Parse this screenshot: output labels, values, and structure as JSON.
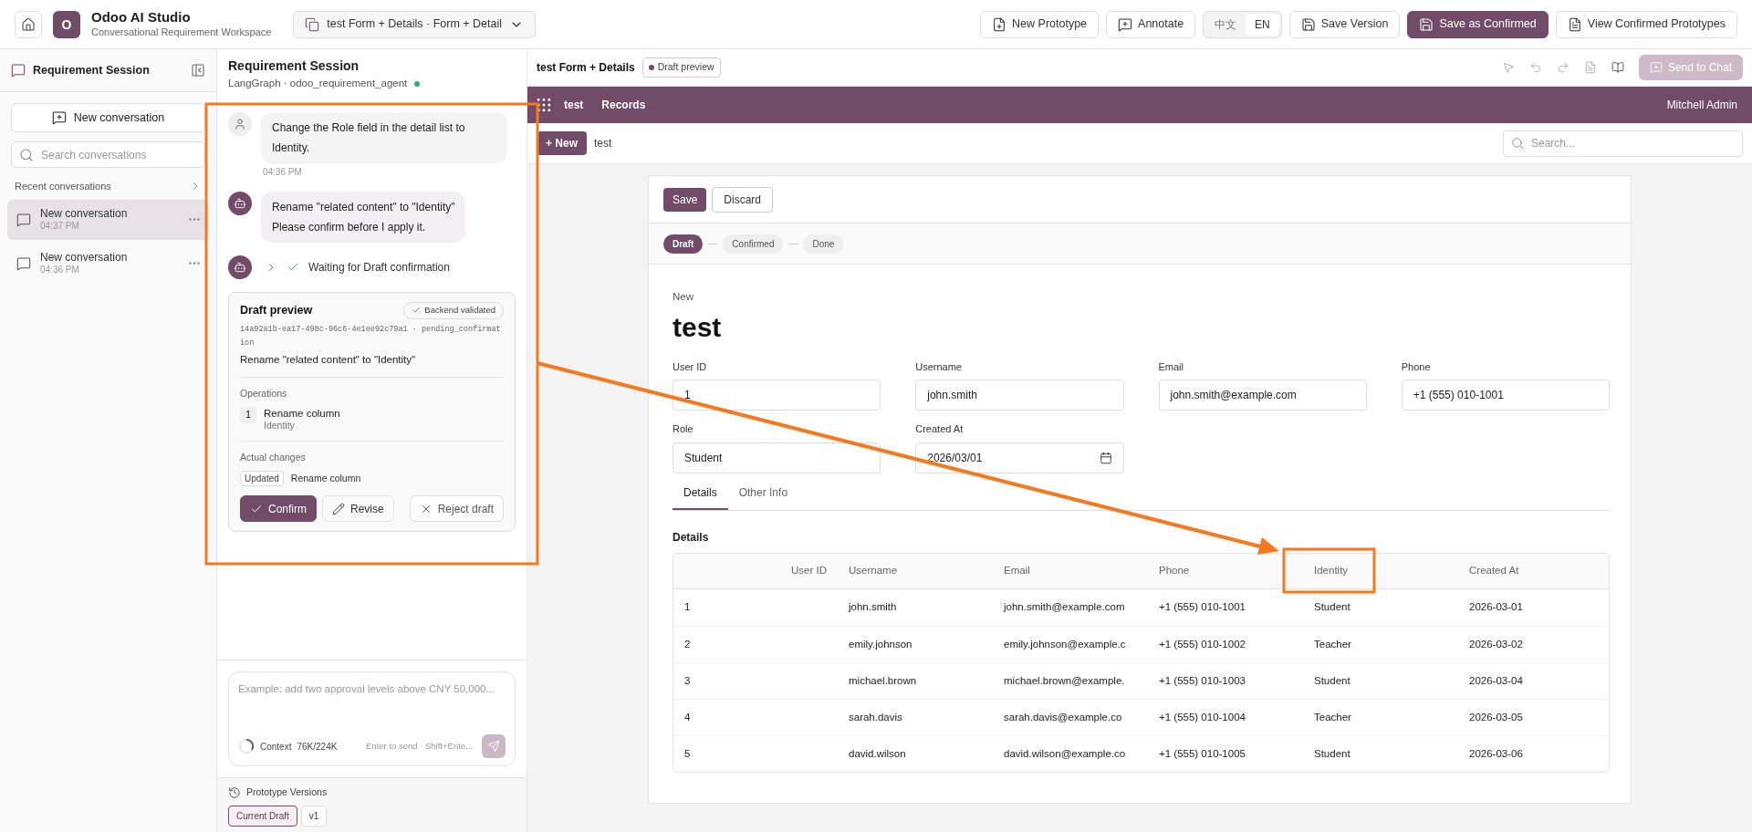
{
  "app": {
    "logo_letter": "O",
    "title": "Odoo AI Studio",
    "subtitle": "Conversational Requirement Workspace",
    "prototype_select": "test Form + Details · Form + Detail"
  },
  "toolbar": {
    "tools": [
      {
        "label": "New Prototype",
        "kind": "new"
      },
      {
        "label": "Annotate",
        "kind": "annotate"
      }
    ],
    "languages": [
      {
        "label": "中文",
        "selected": false
      },
      {
        "label": "EN",
        "selected": true
      }
    ],
    "actions": [
      {
        "label": "Save Version",
        "kind": "save",
        "primary": false
      },
      {
        "label": "Save as Confirmed",
        "kind": "save",
        "primary": true
      },
      {
        "label": "View Confirmed Prototypes",
        "kind": "doc",
        "primary": false
      }
    ]
  },
  "sidebar": {
    "title": "Requirement Session",
    "new_button": "New conversation",
    "search": {
      "placeholder": "Search conversations"
    },
    "section": "Recent conversations",
    "conversations": [
      {
        "title": "New conversation",
        "time": "04:37 PM",
        "selected": true
      },
      {
        "title": "New conversation",
        "time": "04:36 PM",
        "selected": false
      }
    ]
  },
  "chat": {
    "title": "Requirement Session",
    "subtitle": "LangGraph · odoo_requirement_agent",
    "online": true,
    "messages": [
      {
        "kind": "user",
        "lines": [
          "Change the Role field in the detail list to Identity."
        ],
        "time": "04:36 PM"
      },
      {
        "kind": "assistant",
        "lines": [
          "Rename \"related content\" to \"Identity\"",
          "Please confirm before I apply it."
        ]
      }
    ],
    "status": {
      "text": "Waiting for Draft confirmation",
      "done": true
    },
    "draft": {
      "title": "Draft preview",
      "badge": "Backend validated",
      "id_line": "14a92a1b-ea17-498c-96c6-4e1ee92c79a1 · pending_confirmation",
      "summary": "Rename \"related content\" to \"Identity\"",
      "operations_label": "Operations",
      "operations": [
        {
          "index": "1",
          "title": "Rename column",
          "detail": "Identity"
        }
      ],
      "changes_label": "Actual changes",
      "changes": [
        {
          "tag": "Updated",
          "text": "Rename column"
        }
      ],
      "buttons": [
        {
          "label": "Confirm",
          "kind": "confirm"
        },
        {
          "label": "Revise",
          "kind": "revise"
        },
        {
          "label": "Reject draft",
          "kind": "reject"
        }
      ]
    },
    "composer": {
      "placeholder": "Example: add two approval levels above CNY 50,000...",
      "context_label": "Context",
      "context_value": "76K/224K",
      "level": 0.34,
      "hint": "Enter to send · Shift+Ente..."
    },
    "versions": {
      "title": "Prototype Versions",
      "items": [
        {
          "label": "Current Draft",
          "selected": true
        },
        {
          "label": "v1",
          "selected": false
        }
      ]
    }
  },
  "preview": {
    "title": "test Form + Details",
    "badge": "Draft preview",
    "send_button": {
      "label": "Send to Chat",
      "disabled": true
    },
    "navbar": {
      "app": "test",
      "menu": "Records",
      "user": "Mitchell Admin"
    },
    "control": {
      "new_button": "+ New",
      "breadcrumb": "test",
      "search_placeholder": "Search..."
    },
    "form": {
      "save": "Save",
      "discard": "Discard",
      "stages": [
        {
          "label": "Draft",
          "selected": true
        },
        {
          "label": "Confirmed",
          "selected": false
        },
        {
          "label": "Done",
          "selected": false
        }
      ],
      "record_label": "New",
      "record_title": "test",
      "fields": [
        {
          "label": "User ID",
          "value": "1",
          "kind": "text"
        },
        {
          "label": "Username",
          "value": "john.smith",
          "kind": "text"
        },
        {
          "label": "Email",
          "value": "john.smith@example.com",
          "kind": "text"
        },
        {
          "label": "Phone",
          "value": "+1 (555) 010-1001",
          "kind": "text"
        },
        {
          "label": "Role",
          "value": "Student",
          "kind": "text"
        },
        {
          "label": "Created At",
          "value": "2026/03/01",
          "kind": "date"
        }
      ],
      "tabs": [
        {
          "label": "Details",
          "selected": true
        },
        {
          "label": "Other Info",
          "selected": false
        }
      ],
      "section": "Details",
      "table": {
        "columns": [
          "User ID",
          "Username",
          "Email",
          "Phone",
          "Identity",
          "Created At"
        ],
        "rows": [
          [
            "1",
            "john.smith",
            "john.smith@example.com",
            "+1 (555) 010-1001",
            "Student",
            "2026-03-01"
          ],
          [
            "2",
            "emily.johnson",
            "emily.johnson@example.c",
            "+1 (555) 010-1002",
            "Teacher",
            "2026-03-02"
          ],
          [
            "3",
            "michael.brown",
            "michael.brown@example.",
            "+1 (555) 010-1003",
            "Student",
            "2026-03-04"
          ],
          [
            "4",
            "sarah.davis",
            "sarah.davis@example.co",
            "+1 (555) 010-1004",
            "Teacher",
            "2026-03-05"
          ],
          [
            "5",
            "david.wilson",
            "david.wilson@example.co",
            "+1 (555) 010-1005",
            "Student",
            "2026-03-06"
          ]
        ]
      }
    }
  }
}
